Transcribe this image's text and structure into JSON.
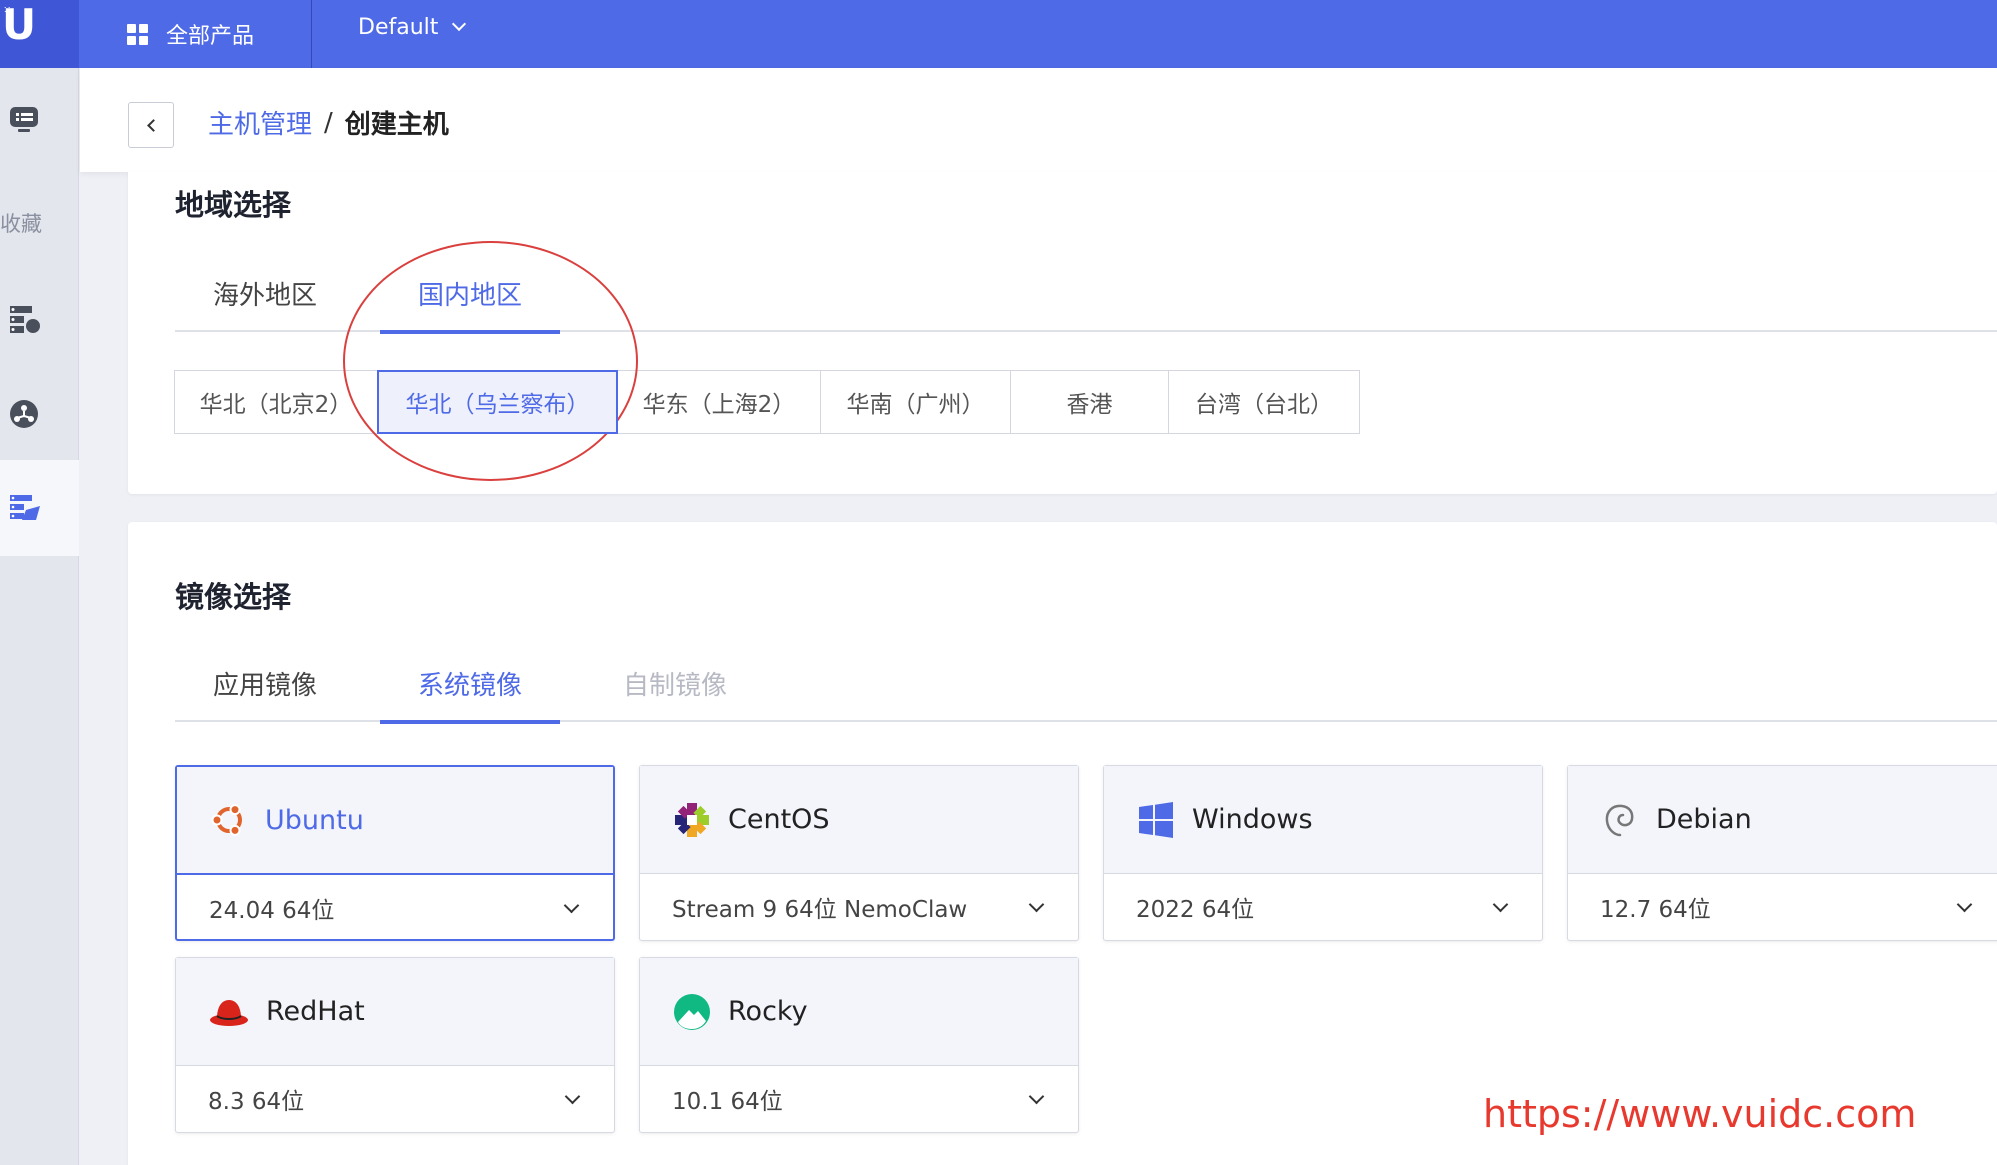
{
  "topbar": {
    "logo": "U",
    "products_label": "全部产品",
    "project_label": "Default"
  },
  "sidebar": {
    "favorites_label": "收藏",
    "items": [
      "monitor-icon",
      "hosts-icon",
      "network-icon",
      "server-list-icon"
    ]
  },
  "header": {
    "breadcrumb_parent": "主机管理",
    "breadcrumb_sep": "/",
    "breadcrumb_current": "创建主机"
  },
  "region_section": {
    "title": "地域选择",
    "tabs": [
      {
        "label": "海外地区",
        "active": false
      },
      {
        "label": "国内地区",
        "active": true
      }
    ],
    "regions": [
      {
        "label": "华北（北京2）",
        "active": false
      },
      {
        "label": "华北（乌兰察布）",
        "active": true
      },
      {
        "label": "华东（上海2）",
        "active": false
      },
      {
        "label": "华南（广州）",
        "active": false
      },
      {
        "label": "香港",
        "active": false
      },
      {
        "label": "台湾（台北）",
        "active": false
      }
    ]
  },
  "image_section": {
    "title": "镜像选择",
    "tabs": [
      {
        "label": "应用镜像",
        "active": false
      },
      {
        "label": "系统镜像",
        "active": true
      },
      {
        "label": "自制镜像",
        "active": false,
        "disabled": true
      }
    ],
    "os": [
      {
        "name": "Ubuntu",
        "version": "24.04 64位",
        "icon": "ubuntu-icon",
        "selected": true
      },
      {
        "name": "CentOS",
        "version": "Stream 9 64位 NemoClaw",
        "icon": "centos-icon",
        "selected": false
      },
      {
        "name": "Windows",
        "version": "2022 64位",
        "icon": "windows-icon",
        "selected": false
      },
      {
        "name": "Debian",
        "version": "12.7 64位",
        "icon": "debian-icon",
        "selected": false
      },
      {
        "name": "RedHat",
        "version": "8.3 64位",
        "icon": "redhat-icon",
        "selected": false
      },
      {
        "name": "Rocky",
        "version": "10.1 64位",
        "icon": "rocky-icon",
        "selected": false
      }
    ]
  },
  "watermark": "https://www.vuidc.com",
  "colors": {
    "primary": "#4f6ae6",
    "annotation": "#d9403e"
  }
}
